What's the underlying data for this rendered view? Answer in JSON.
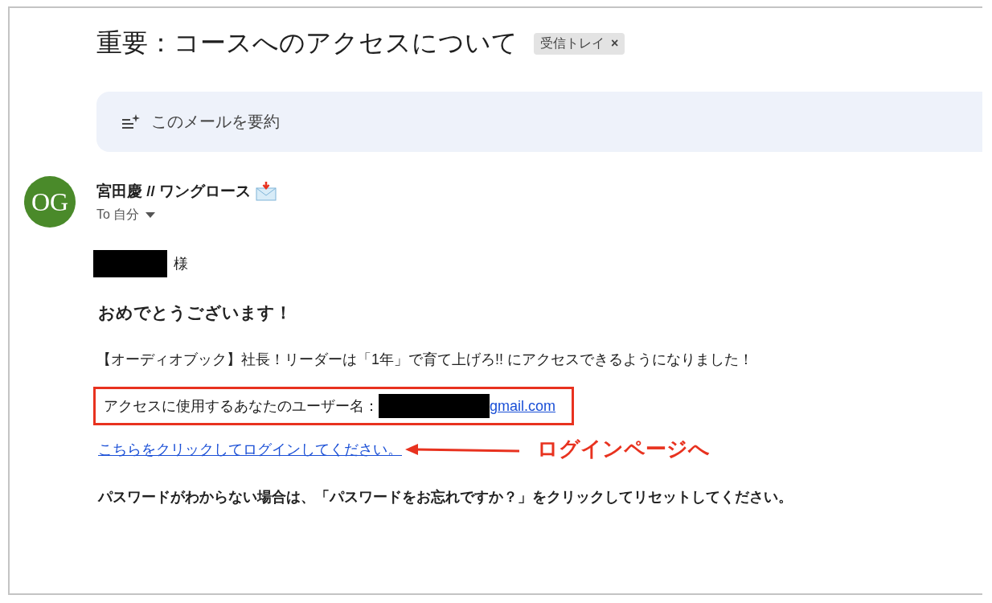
{
  "subject": {
    "title": "重要：コースへのアクセスについて",
    "label": "受信トレイ",
    "label_close": "×"
  },
  "summary_button": {
    "label": "このメールを要約"
  },
  "sender": {
    "avatar_text": "OG",
    "name": "宮田慶 // ワングロース",
    "recipient": "To 自分"
  },
  "body": {
    "salutation": "様",
    "greeting": "おめでとうございます！",
    "message": "【オーディオブック】社長！リーダーは「1年」で育て上げろ!! にアクセスできるようになりました！",
    "username_label": "アクセスに使用するあなたのユーザー名：",
    "username_domain": "gmail.com",
    "login_link": "こちらをクリックしてログインしてください。",
    "password_note": "パスワードがわからない場合は、「パスワードをお忘れですか？」をクリックしてリセットしてください。"
  },
  "annotation": {
    "label": "ログインページへ"
  }
}
